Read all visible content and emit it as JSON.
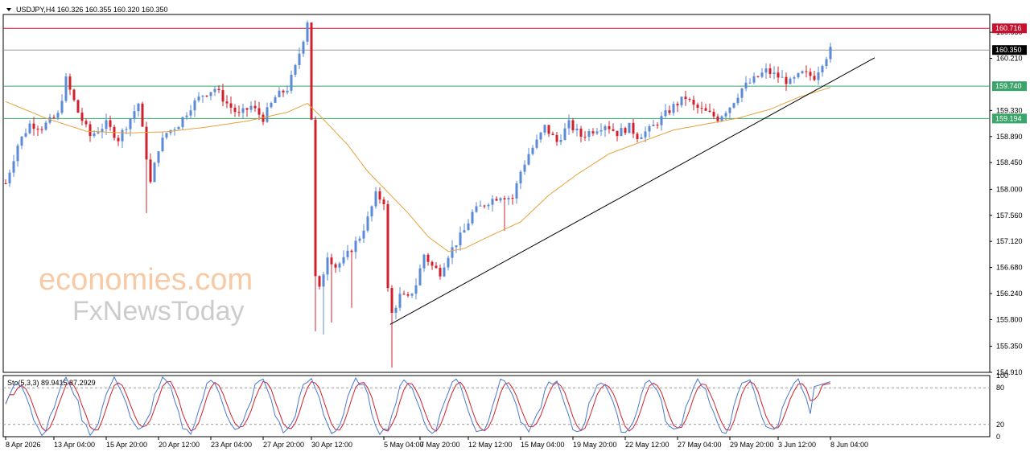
{
  "header": {
    "arrow_icon": "triangle-down-icon",
    "text": "USDJPY,H4  160.326 160.355 160.320 160.350"
  },
  "watermark": {
    "line1": "economies.com",
    "line2": "FxNewsToday",
    "color1": "#f7c9a4",
    "color2": "#cccccc"
  },
  "colors": {
    "bull": "#5b8bd6",
    "bear": "#d0202e",
    "ma": "#e6a23c",
    "trendline": "#000000",
    "resistance": "#c8102e",
    "support": "#3aa56a",
    "stoch_main": "#4a78d0",
    "stoch_signal": "#d0202e"
  },
  "chart_data": [
    {
      "type": "candlestick",
      "symbol": "USDJPY",
      "timeframe": "H4",
      "ohlc_header": {
        "open": 160.326,
        "high": 160.355,
        "low": 160.32,
        "close": 160.35
      },
      "y_ticks": [
        "160.650",
        "160.210",
        "159.330",
        "158.890",
        "158.450",
        "158.000",
        "157.560",
        "157.120",
        "156.680",
        "156.240",
        "155.800",
        "155.350",
        "154.910"
      ],
      "ylim": [
        154.91,
        160.95
      ],
      "x_ticks": [
        "8 Apr 2026",
        "13 Apr 04:00",
        "15 Apr 20:00",
        "20 Apr 12:00",
        "23 Apr 04:00",
        "27 Apr 20:00",
        "30 Apr 12:00",
        "5 May 04:00",
        "7 May 20:00",
        "12 May 12:00",
        "15 May 04:00",
        "19 May 20:00",
        "22 May 12:00",
        "27 May 04:00",
        "29 May 20:00",
        "3 Jun 12:00",
        "8 Jun 04:00"
      ],
      "levels": [
        {
          "value": 160.716,
          "label": "160.716",
          "kind": "resistance"
        },
        {
          "value": 160.35,
          "label": "160.350",
          "kind": "current"
        },
        {
          "value": 159.74,
          "label": "159.740",
          "kind": "support"
        },
        {
          "value": 159.194,
          "label": "159.194",
          "kind": "support"
        }
      ],
      "trendline": {
        "from": {
          "x": "5 May 04:00",
          "y": 155.72
        },
        "to": {
          "x": "8 Jun 16:00",
          "y": 160.22
        }
      },
      "path_waypoints": [
        [
          0,
          158.1
        ],
        [
          3,
          158.75
        ],
        [
          6,
          159.1
        ],
        [
          9,
          159.05
        ],
        [
          13,
          159.25
        ],
        [
          15,
          159.85
        ],
        [
          18,
          159.3
        ],
        [
          21,
          158.9
        ],
        [
          25,
          159.1
        ],
        [
          28,
          158.85
        ],
        [
          31,
          159.2
        ],
        [
          33,
          159.45
        ],
        [
          35,
          158.55
        ],
        [
          36,
          158.1
        ],
        [
          38,
          158.7
        ],
        [
          40,
          158.95
        ],
        [
          43,
          159.1
        ],
        [
          46,
          159.4
        ],
        [
          49,
          159.6
        ],
        [
          52,
          159.7
        ],
        [
          55,
          159.45
        ],
        [
          58,
          159.25
        ],
        [
          61,
          159.4
        ],
        [
          64,
          159.2
        ],
        [
          67,
          159.55
        ],
        [
          70,
          159.7
        ],
        [
          72,
          160.05
        ],
        [
          74,
          160.55
        ],
        [
          75,
          160.85
        ],
        [
          76,
          159.2
        ],
        [
          77,
          156.5
        ],
        [
          78,
          156.3
        ],
        [
          80,
          156.9
        ],
        [
          82,
          156.7
        ],
        [
          84,
          156.8
        ],
        [
          86,
          157.0
        ],
        [
          88,
          157.2
        ],
        [
          90,
          157.5
        ],
        [
          92,
          157.9
        ],
        [
          94,
          157.8
        ],
        [
          95,
          156.3
        ],
        [
          96,
          155.9
        ],
        [
          98,
          156.2
        ],
        [
          100,
          156.15
        ],
        [
          102,
          156.4
        ],
        [
          104,
          156.9
        ],
        [
          106,
          156.7
        ],
        [
          108,
          156.6
        ],
        [
          110,
          156.9
        ],
        [
          112,
          157.1
        ],
        [
          114,
          157.3
        ],
        [
          116,
          157.6
        ],
        [
          118,
          157.7
        ],
        [
          120,
          157.8
        ],
        [
          123,
          157.9
        ],
        [
          126,
          157.85
        ],
        [
          128,
          158.3
        ],
        [
          130,
          158.6
        ],
        [
          132,
          158.8
        ],
        [
          134,
          159.05
        ],
        [
          137,
          158.8
        ],
        [
          140,
          159.1
        ],
        [
          143,
          158.9
        ],
        [
          146,
          159.0
        ],
        [
          149,
          159.1
        ],
        [
          152,
          158.95
        ],
        [
          155,
          159.05
        ],
        [
          157,
          158.9
        ],
        [
          160,
          159.0
        ],
        [
          163,
          159.2
        ],
        [
          166,
          159.4
        ],
        [
          169,
          159.55
        ],
        [
          171,
          159.4
        ],
        [
          174,
          159.3
        ],
        [
          177,
          159.2
        ],
        [
          180,
          159.4
        ],
        [
          183,
          159.7
        ],
        [
          186,
          159.85
        ],
        [
          189,
          160.0
        ],
        [
          192,
          159.9
        ],
        [
          195,
          159.8
        ],
        [
          198,
          159.95
        ],
        [
          201,
          159.9
        ],
        [
          203,
          160.15
        ],
        [
          205,
          160.35
        ]
      ],
      "moving_average_waypoints": [
        [
          0,
          159.48
        ],
        [
          10,
          159.2
        ],
        [
          20,
          158.98
        ],
        [
          30,
          158.95
        ],
        [
          40,
          158.97
        ],
        [
          50,
          159.05
        ],
        [
          60,
          159.15
        ],
        [
          70,
          159.3
        ],
        [
          75,
          159.45
        ],
        [
          78,
          159.25
        ],
        [
          85,
          158.75
        ],
        [
          90,
          158.3
        ],
        [
          95,
          157.95
        ],
        [
          100,
          157.6
        ],
        [
          105,
          157.2
        ],
        [
          110,
          156.95
        ],
        [
          114,
          157.0
        ],
        [
          120,
          157.2
        ],
        [
          128,
          157.45
        ],
        [
          135,
          157.9
        ],
        [
          142,
          158.25
        ],
        [
          150,
          158.6
        ],
        [
          158,
          158.8
        ],
        [
          166,
          159.0
        ],
        [
          174,
          159.1
        ],
        [
          182,
          159.2
        ],
        [
          190,
          159.35
        ],
        [
          197,
          159.55
        ],
        [
          205,
          159.72
        ]
      ]
    },
    {
      "type": "line",
      "indicator": "Stochastic",
      "label": "Sto(5,3,3) 89.9415 87.2929",
      "main": 89.9415,
      "signal": 87.2929,
      "ylim": [
        0,
        100
      ],
      "y_ticks": [
        "100",
        "80",
        "20",
        "0"
      ],
      "levels": [
        20,
        80
      ]
    }
  ]
}
